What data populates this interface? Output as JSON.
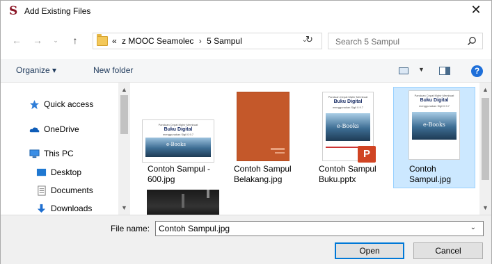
{
  "window": {
    "title": "Add Existing Files",
    "app_glyph": "S"
  },
  "nav": {
    "back_icon": "back-arrow-icon",
    "forward_icon": "forward-arrow-icon",
    "recent_icon": "chevron-down-icon",
    "up_icon": "up-arrow-icon"
  },
  "address": {
    "overflow": "«",
    "crumbs": [
      "z MOOC Seamolec",
      "5 Sampul"
    ],
    "separator": "›"
  },
  "search": {
    "placeholder": "Search 5 Sampul"
  },
  "toolbar": {
    "organize_label": "Organize ▾",
    "new_folder_label": "New folder",
    "help": "?"
  },
  "sidebar": {
    "items": [
      {
        "label": "Quick access",
        "icon": "star-icon"
      },
      {
        "label": "OneDrive",
        "icon": "cloud-icon"
      },
      {
        "label": "This PC",
        "icon": "computer-icon"
      },
      {
        "label": "Desktop",
        "icon": "desktop-icon"
      },
      {
        "label": "Documents",
        "icon": "documents-icon"
      },
      {
        "label": "Downloads",
        "icon": "download-icon"
      }
    ]
  },
  "files": [
    {
      "name_line1": "Contoh Sampul -",
      "name_line2": "600.jpg",
      "selected": false
    },
    {
      "name_line1": "Contoh Sampul",
      "name_line2": "Belakang.jpg",
      "selected": false
    },
    {
      "name_line1": "Contoh Sampul",
      "name_line2": "Buku.pptx",
      "selected": false
    },
    {
      "name_line1": "Contoh",
      "name_line2": "Sampul.jpg",
      "selected": true
    }
  ],
  "thumb_text": {
    "cover_title": "Buku Digital",
    "cover_sub": "menggunakan Sigil 0.9.7",
    "cover_top": "Panduan Cepat Mahir Membuat",
    "ebooks": "e-Books",
    "pptx_badge": "P"
  },
  "footer": {
    "filename_label": "File name:",
    "filename_value": "Contoh Sampul.jpg",
    "open_label": "Open",
    "cancel_label": "Cancel"
  },
  "colors": {
    "accent": "#0078d7",
    "selection": "#cce8ff",
    "brand": "#8a1525",
    "orange_cover": "#c4582a"
  }
}
